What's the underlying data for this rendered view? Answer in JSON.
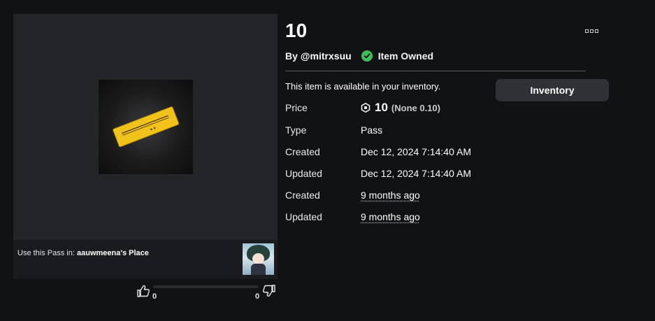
{
  "item": {
    "title": "10",
    "by_label": "By",
    "creator": "@mitrxsuu",
    "owned_label": "Item Owned",
    "available_text": "This item is available in your inventory.",
    "inventory_button": "Inventory"
  },
  "details": {
    "price_label": "Price",
    "price_amount": "10",
    "price_note": "(None 0.10)",
    "type_label": "Type",
    "type_value": "Pass",
    "created_label": "Created",
    "created_value": "Dec 12, 2024 7:14:40 AM",
    "updated_label": "Updated",
    "updated_value": "Dec 12, 2024 7:14:40 AM",
    "created_relative_label": "Created",
    "created_relative_value": "9 months ago",
    "updated_relative_label": "Updated",
    "updated_relative_value": "9 months ago"
  },
  "place": {
    "prefix": "Use this Pass in:",
    "name": "aauwmeena's Place"
  },
  "votes": {
    "up_count": "0",
    "down_count": "0"
  },
  "icons": {
    "more": "ellipsis-icon",
    "owned": "checkmark-icon",
    "currency": "robux-icon",
    "thumb_up": "thumbs-up-icon",
    "thumb_down": "thumbs-down-icon"
  },
  "colors": {
    "background": "#111214",
    "panel": "#232529",
    "owned_green": "#3fbf5b",
    "ticket_yellow": "#f0c21a",
    "button_bg": "#2f3136"
  }
}
